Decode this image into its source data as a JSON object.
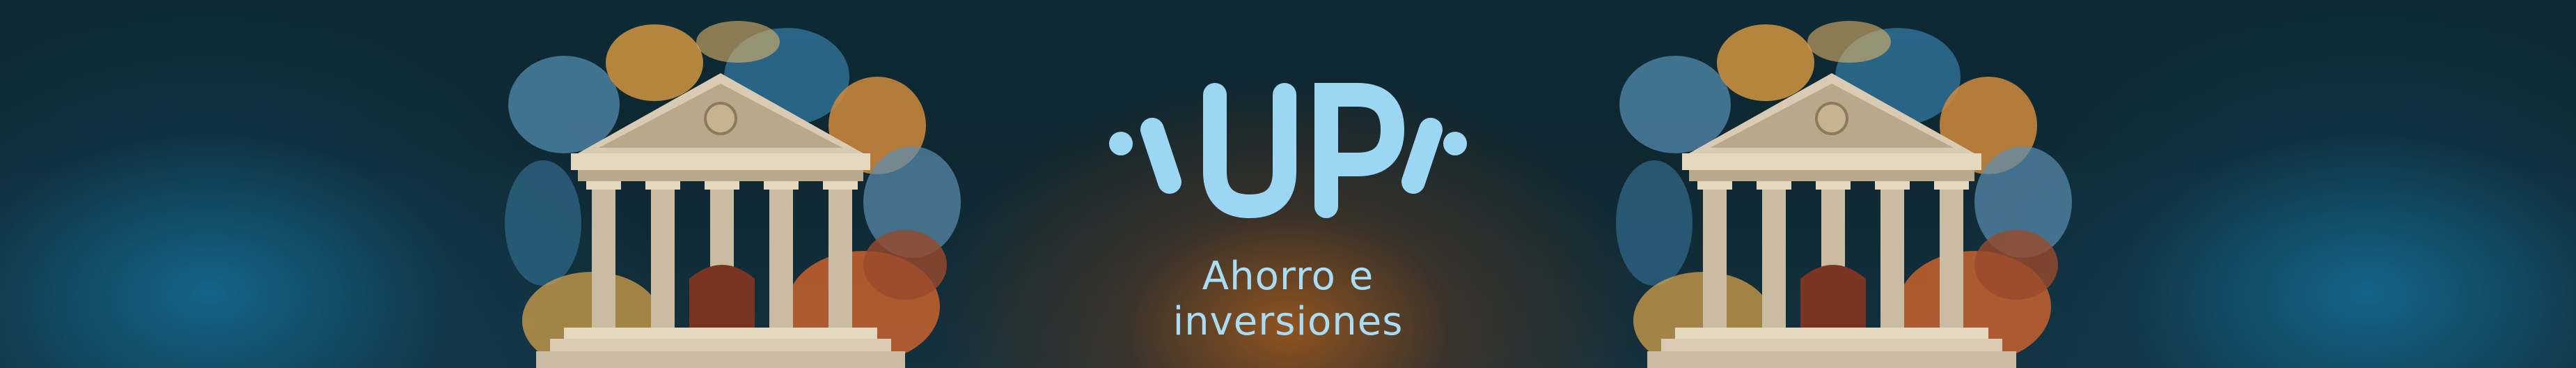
{
  "banner": {
    "logo_text": "UP",
    "tagline": "Ahorro e inversiones"
  },
  "colors": {
    "logo": "#9bd6f5",
    "background_dark": "#0f2730",
    "accent_teal": "#146e96",
    "accent_orange": "#96551e"
  },
  "icons": {
    "left_illustration": "bank-building-icon",
    "right_illustration": "bank-building-icon"
  }
}
